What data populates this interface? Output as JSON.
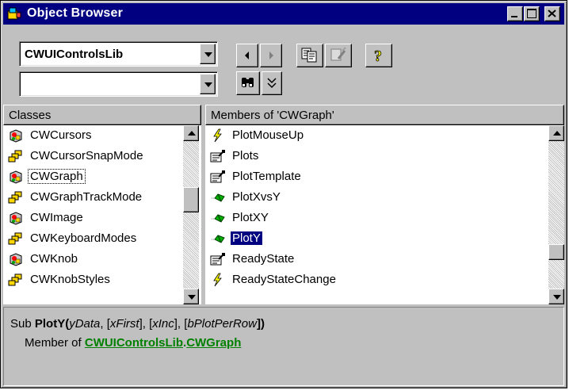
{
  "window": {
    "title": "Object Browser",
    "colors": {
      "titlebar": "#000080",
      "face": "#c0c0c0",
      "selection": "#000080"
    }
  },
  "toolbar": {
    "library_value": "CWUIControlsLib",
    "search_value": "",
    "buttons": [
      "back-icon",
      "forward-icon",
      "copy-icon",
      "view-definition-icon",
      "help-icon",
      "find-icon",
      "show-hide-results-icon"
    ]
  },
  "classes": {
    "header": "Classes",
    "items": [
      {
        "label": "CWCursors",
        "icon": "class-icon"
      },
      {
        "label": "CWCursorSnapMode",
        "icon": "enum-icon"
      },
      {
        "label": "CWGraph",
        "icon": "class-icon",
        "focused": true
      },
      {
        "label": "CWGraphTrackMode",
        "icon": "enum-icon"
      },
      {
        "label": "CWImage",
        "icon": "class-icon"
      },
      {
        "label": "CWKeyboardModes",
        "icon": "enum-icon"
      },
      {
        "label": "CWKnob",
        "icon": "class-icon"
      },
      {
        "label": "CWKnobStyles",
        "icon": "enum-icon"
      }
    ]
  },
  "members": {
    "header": "Members of 'CWGraph'",
    "items": [
      {
        "label": "PlotMouseUp",
        "icon": "event-icon"
      },
      {
        "label": "Plots",
        "icon": "property-icon"
      },
      {
        "label": "PlotTemplate",
        "icon": "property-icon"
      },
      {
        "label": "PlotXvsY",
        "icon": "method-icon"
      },
      {
        "label": "PlotXY",
        "icon": "method-icon"
      },
      {
        "label": "PlotY",
        "icon": "method-icon",
        "selected": true
      },
      {
        "label": "ReadyState",
        "icon": "property-icon"
      },
      {
        "label": "ReadyStateChange",
        "icon": "event-icon"
      }
    ]
  },
  "details": {
    "prefix": "Sub ",
    "name": "PlotY",
    "open": "(",
    "param1": "yData",
    "sep1": ", [",
    "param2": "xFirst",
    "sep2": "], [",
    "param3": "xInc",
    "sep3": "], [",
    "param4": "bPlotPerRow",
    "close": "])",
    "member_prefix": "Member of ",
    "member_lib": "CWUIControlsLib",
    "member_dot": ".",
    "member_class": "CWGraph"
  }
}
